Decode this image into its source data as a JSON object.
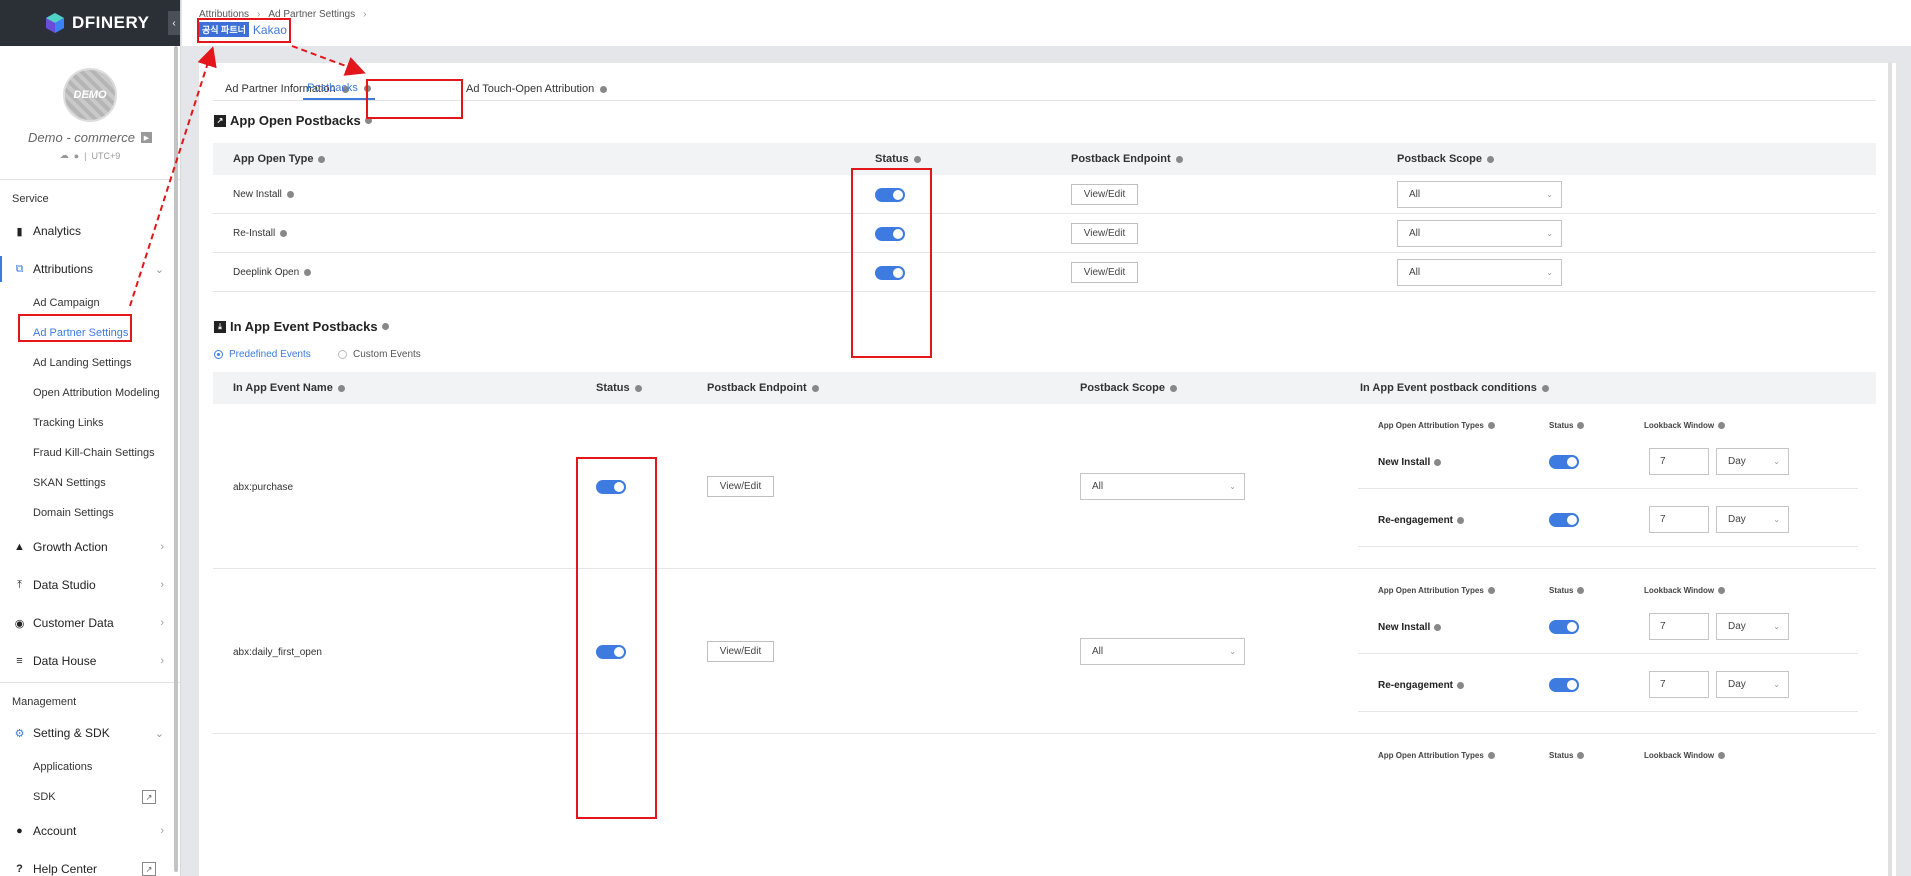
{
  "brand": {
    "logo_text": "DFINERY",
    "logo_icon": "dfinery-cube-icon",
    "collapse_icon": "chevron-left-icon"
  },
  "profile": {
    "avatar_text": "DEMO",
    "app_name": "Demo - commerce",
    "timezone": "UTC+9",
    "platforms": [
      "android-icon",
      "apple-icon"
    ]
  },
  "sidebar": {
    "service_label": "Service",
    "management_label": "Management",
    "items": [
      {
        "label": "Analytics",
        "icon": "bar-chart-icon"
      },
      {
        "label": "Attributions",
        "icon": "attribution-icon"
      },
      {
        "label": "Growth Action",
        "icon": "growth-icon"
      },
      {
        "label": "Data Studio",
        "icon": "upload-icon"
      },
      {
        "label": "Customer Data",
        "icon": "target-icon"
      },
      {
        "label": "Data House",
        "icon": "database-icon"
      },
      {
        "label": "Setting & SDK",
        "icon": "gear-icon"
      },
      {
        "label": "Account",
        "icon": "user-icon"
      },
      {
        "label": "Help Center",
        "icon": "question-icon"
      }
    ],
    "attribution_sub": [
      "Ad Campaign",
      "Ad Partner Settings",
      "Ad Landing Settings",
      "Open Attribution Modeling",
      "Tracking Links",
      "Fraud Kill-Chain Settings",
      "SKAN Settings",
      "Domain Settings"
    ],
    "setting_sub": [
      "Applications",
      "SDK"
    ]
  },
  "breadcrumb": {
    "items": [
      "Attributions",
      "Ad Partner Settings"
    ],
    "partner_badge": "공식 파트너",
    "partner_name": "Kakao"
  },
  "tabs": [
    "Ad Partner Information",
    "Postbacks",
    "Ad Touch-Open Attribution"
  ],
  "app_open": {
    "title": "App Open Postbacks",
    "headers": [
      "App Open Type",
      "Status",
      "Postback Endpoint",
      "Postback Scope"
    ],
    "rows": [
      {
        "type": "New Install",
        "status": true,
        "endpoint_btn": "View/Edit",
        "scope": "All"
      },
      {
        "type": "Re-Install",
        "status": true,
        "endpoint_btn": "View/Edit",
        "scope": "All"
      },
      {
        "type": "Deeplink Open",
        "status": true,
        "endpoint_btn": "View/Edit",
        "scope": "All"
      }
    ]
  },
  "in_app": {
    "title": "In App Event Postbacks",
    "radios": [
      "Predefined Events",
      "Custom Events"
    ],
    "selected_radio": "Predefined Events",
    "headers": [
      "In App Event Name",
      "Status",
      "Postback Endpoint",
      "Postback Scope",
      "In App Event postback conditions"
    ],
    "cond_headers": [
      "App Open Attribution Types",
      "Status",
      "Lookback Window"
    ],
    "rows": [
      {
        "name": "abx:purchase",
        "status": true,
        "endpoint_btn": "View/Edit",
        "scope": "All",
        "conditions": [
          {
            "type": "New Install",
            "status": true,
            "window": "7",
            "unit": "Day"
          },
          {
            "type": "Re-engagement",
            "status": true,
            "window": "7",
            "unit": "Day"
          }
        ]
      },
      {
        "name": "abx:daily_first_open",
        "status": true,
        "endpoint_btn": "View/Edit",
        "scope": "All",
        "conditions": [
          {
            "type": "New Install",
            "status": true,
            "window": "7",
            "unit": "Day"
          },
          {
            "type": "Re-engagement",
            "status": true,
            "window": "7",
            "unit": "Day"
          }
        ]
      }
    ]
  },
  "annotation_color": "#e3161b",
  "accent_color": "#3d7be0"
}
